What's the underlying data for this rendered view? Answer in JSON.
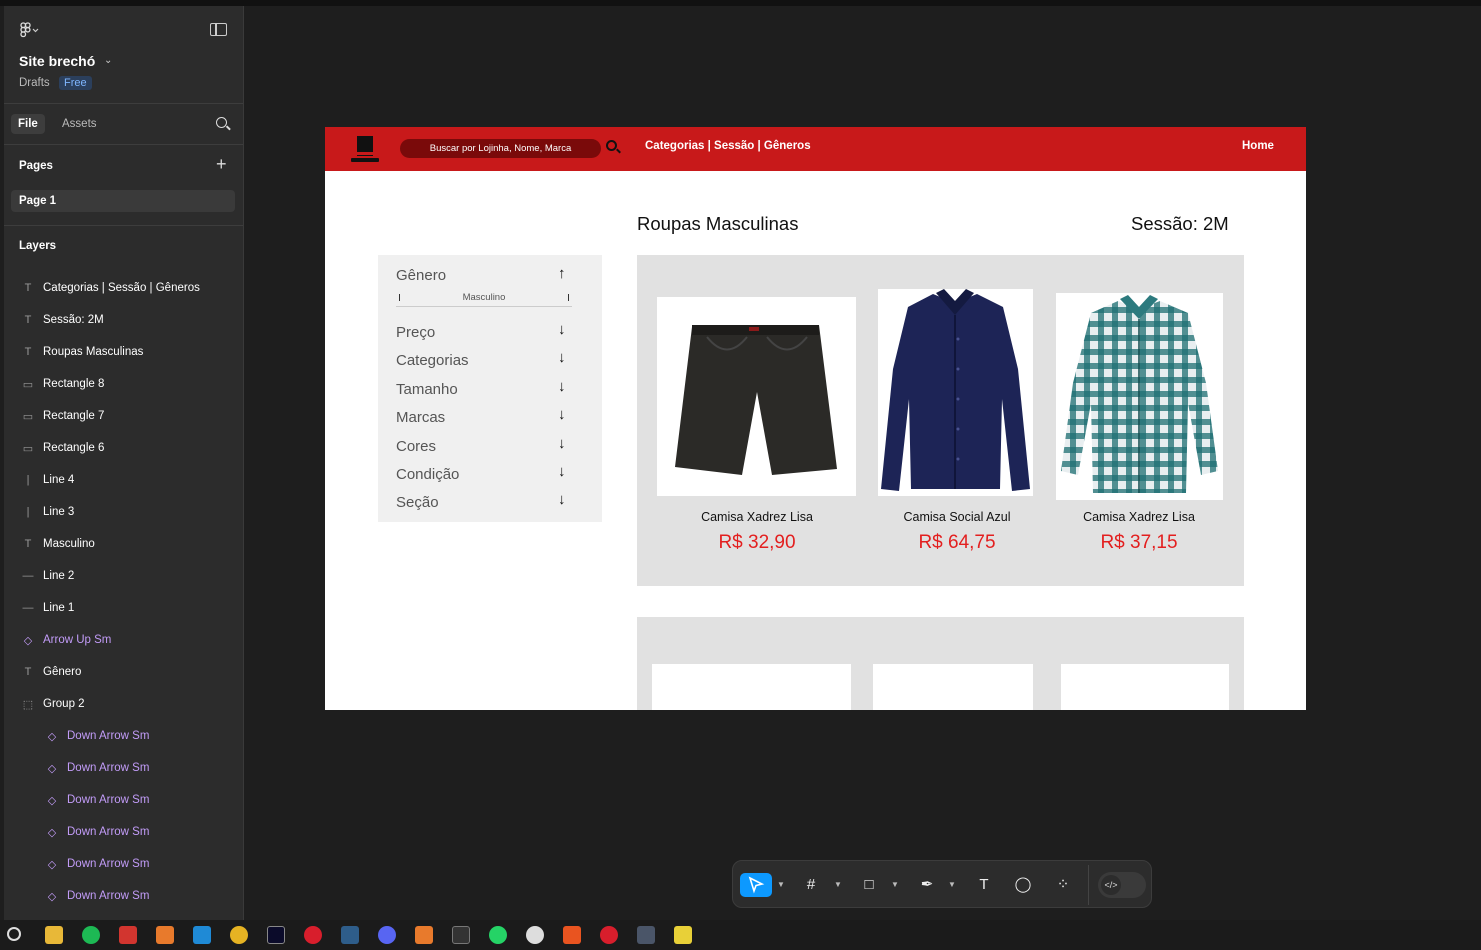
{
  "sidebar": {
    "project_name": "Site brechó",
    "drafts_label": "Drafts",
    "plan_badge": "Free",
    "tab_file": "File",
    "tab_assets": "Assets",
    "pages_title": "Pages",
    "page_item": "Page 1",
    "layers_title": "Layers",
    "layers": [
      {
        "icon": "T",
        "label": "Categorias | Sessão | Gêneros"
      },
      {
        "icon": "T",
        "label": "Sessão: 2M"
      },
      {
        "icon": "T",
        "label": "Roupas Masculinas"
      },
      {
        "icon": "▭",
        "label": "Rectangle 8"
      },
      {
        "icon": "▭",
        "label": "Rectangle 7"
      },
      {
        "icon": "▭",
        "label": "Rectangle 6"
      },
      {
        "icon": "|",
        "label": "Line 4"
      },
      {
        "icon": "|",
        "label": "Line 3"
      },
      {
        "icon": "T",
        "label": "Masculino"
      },
      {
        "icon": "—",
        "label": "Line 2"
      },
      {
        "icon": "—",
        "label": "Line 1"
      },
      {
        "icon": "◇",
        "label": "Arrow Up Sm"
      },
      {
        "icon": "T",
        "label": "Gênero"
      },
      {
        "icon": "⬚",
        "label": "Group 2"
      },
      {
        "icon": "◇",
        "label": "Down Arrow Sm"
      },
      {
        "icon": "◇",
        "label": "Down Arrow Sm"
      },
      {
        "icon": "◇",
        "label": "Down Arrow Sm"
      },
      {
        "icon": "◇",
        "label": "Down Arrow Sm"
      },
      {
        "icon": "◇",
        "label": "Down Arrow Sm"
      },
      {
        "icon": "◇",
        "label": "Down Arrow Sm"
      }
    ]
  },
  "site": {
    "search_placeholder": "Buscar por Lojinha, Nome, Marca",
    "nav_links": "Categorias | Sessão | Gêneros",
    "home_link": "Home",
    "page_title": "Roupas Masculinas",
    "session_label": "Sessão: 2M",
    "filters": {
      "genero": "Gênero",
      "genero_value": "Masculino",
      "items": [
        "Preço",
        "Categorias",
        "Tamanho",
        "Marcas",
        "Cores",
        "Condição",
        "Seção"
      ]
    },
    "products": [
      {
        "name": "Camisa Xadrez Lisa",
        "price": "R$ 32,90"
      },
      {
        "name": "Camisa Social Azul",
        "price": "R$ 64,75"
      },
      {
        "name": "Camisa Xadrez Lisa",
        "price": "R$ 37,15"
      }
    ]
  },
  "colors": {
    "accent_red": "#c8191a",
    "price_red": "#e31f1f",
    "figma_blue": "#0d99ff",
    "component_purple": "#c29cf8"
  }
}
